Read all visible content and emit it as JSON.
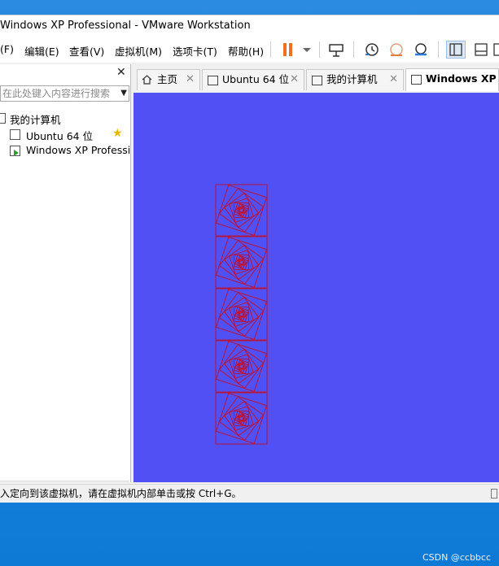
{
  "window": {
    "title": "Windows XP Professional - VMware Workstation"
  },
  "menu": {
    "items": [
      "(F)",
      "编辑(E)",
      "查看(V)",
      "虚拟机(M)",
      "选项卡(T)",
      "帮助(H)"
    ]
  },
  "library": {
    "close_label": "✕",
    "search_placeholder": "在此处键入内容进行搜索",
    "root_label": "我的计算机",
    "items": [
      {
        "label": "Ubuntu 64 位",
        "starred": true
      },
      {
        "label": "Windows XP Professional",
        "running": true
      }
    ]
  },
  "tabs": [
    {
      "label": "主页",
      "active": false
    },
    {
      "label": "Ubuntu 64 位",
      "active": false
    },
    {
      "label": "我的计算机",
      "active": false
    },
    {
      "label": "Windows XP Pro",
      "active": true
    }
  ],
  "vm": {
    "background": "#5050f5",
    "pattern_color": "#c0102a",
    "pattern_count": 5
  },
  "status": {
    "message": "入定向到该虚拟机，请在虚拟机内部单击或按 Ctrl+G。"
  },
  "watermark": "CSDN @ccbbcc",
  "colors": {
    "pause": "#f07020",
    "accent": "#2b7bd9"
  }
}
